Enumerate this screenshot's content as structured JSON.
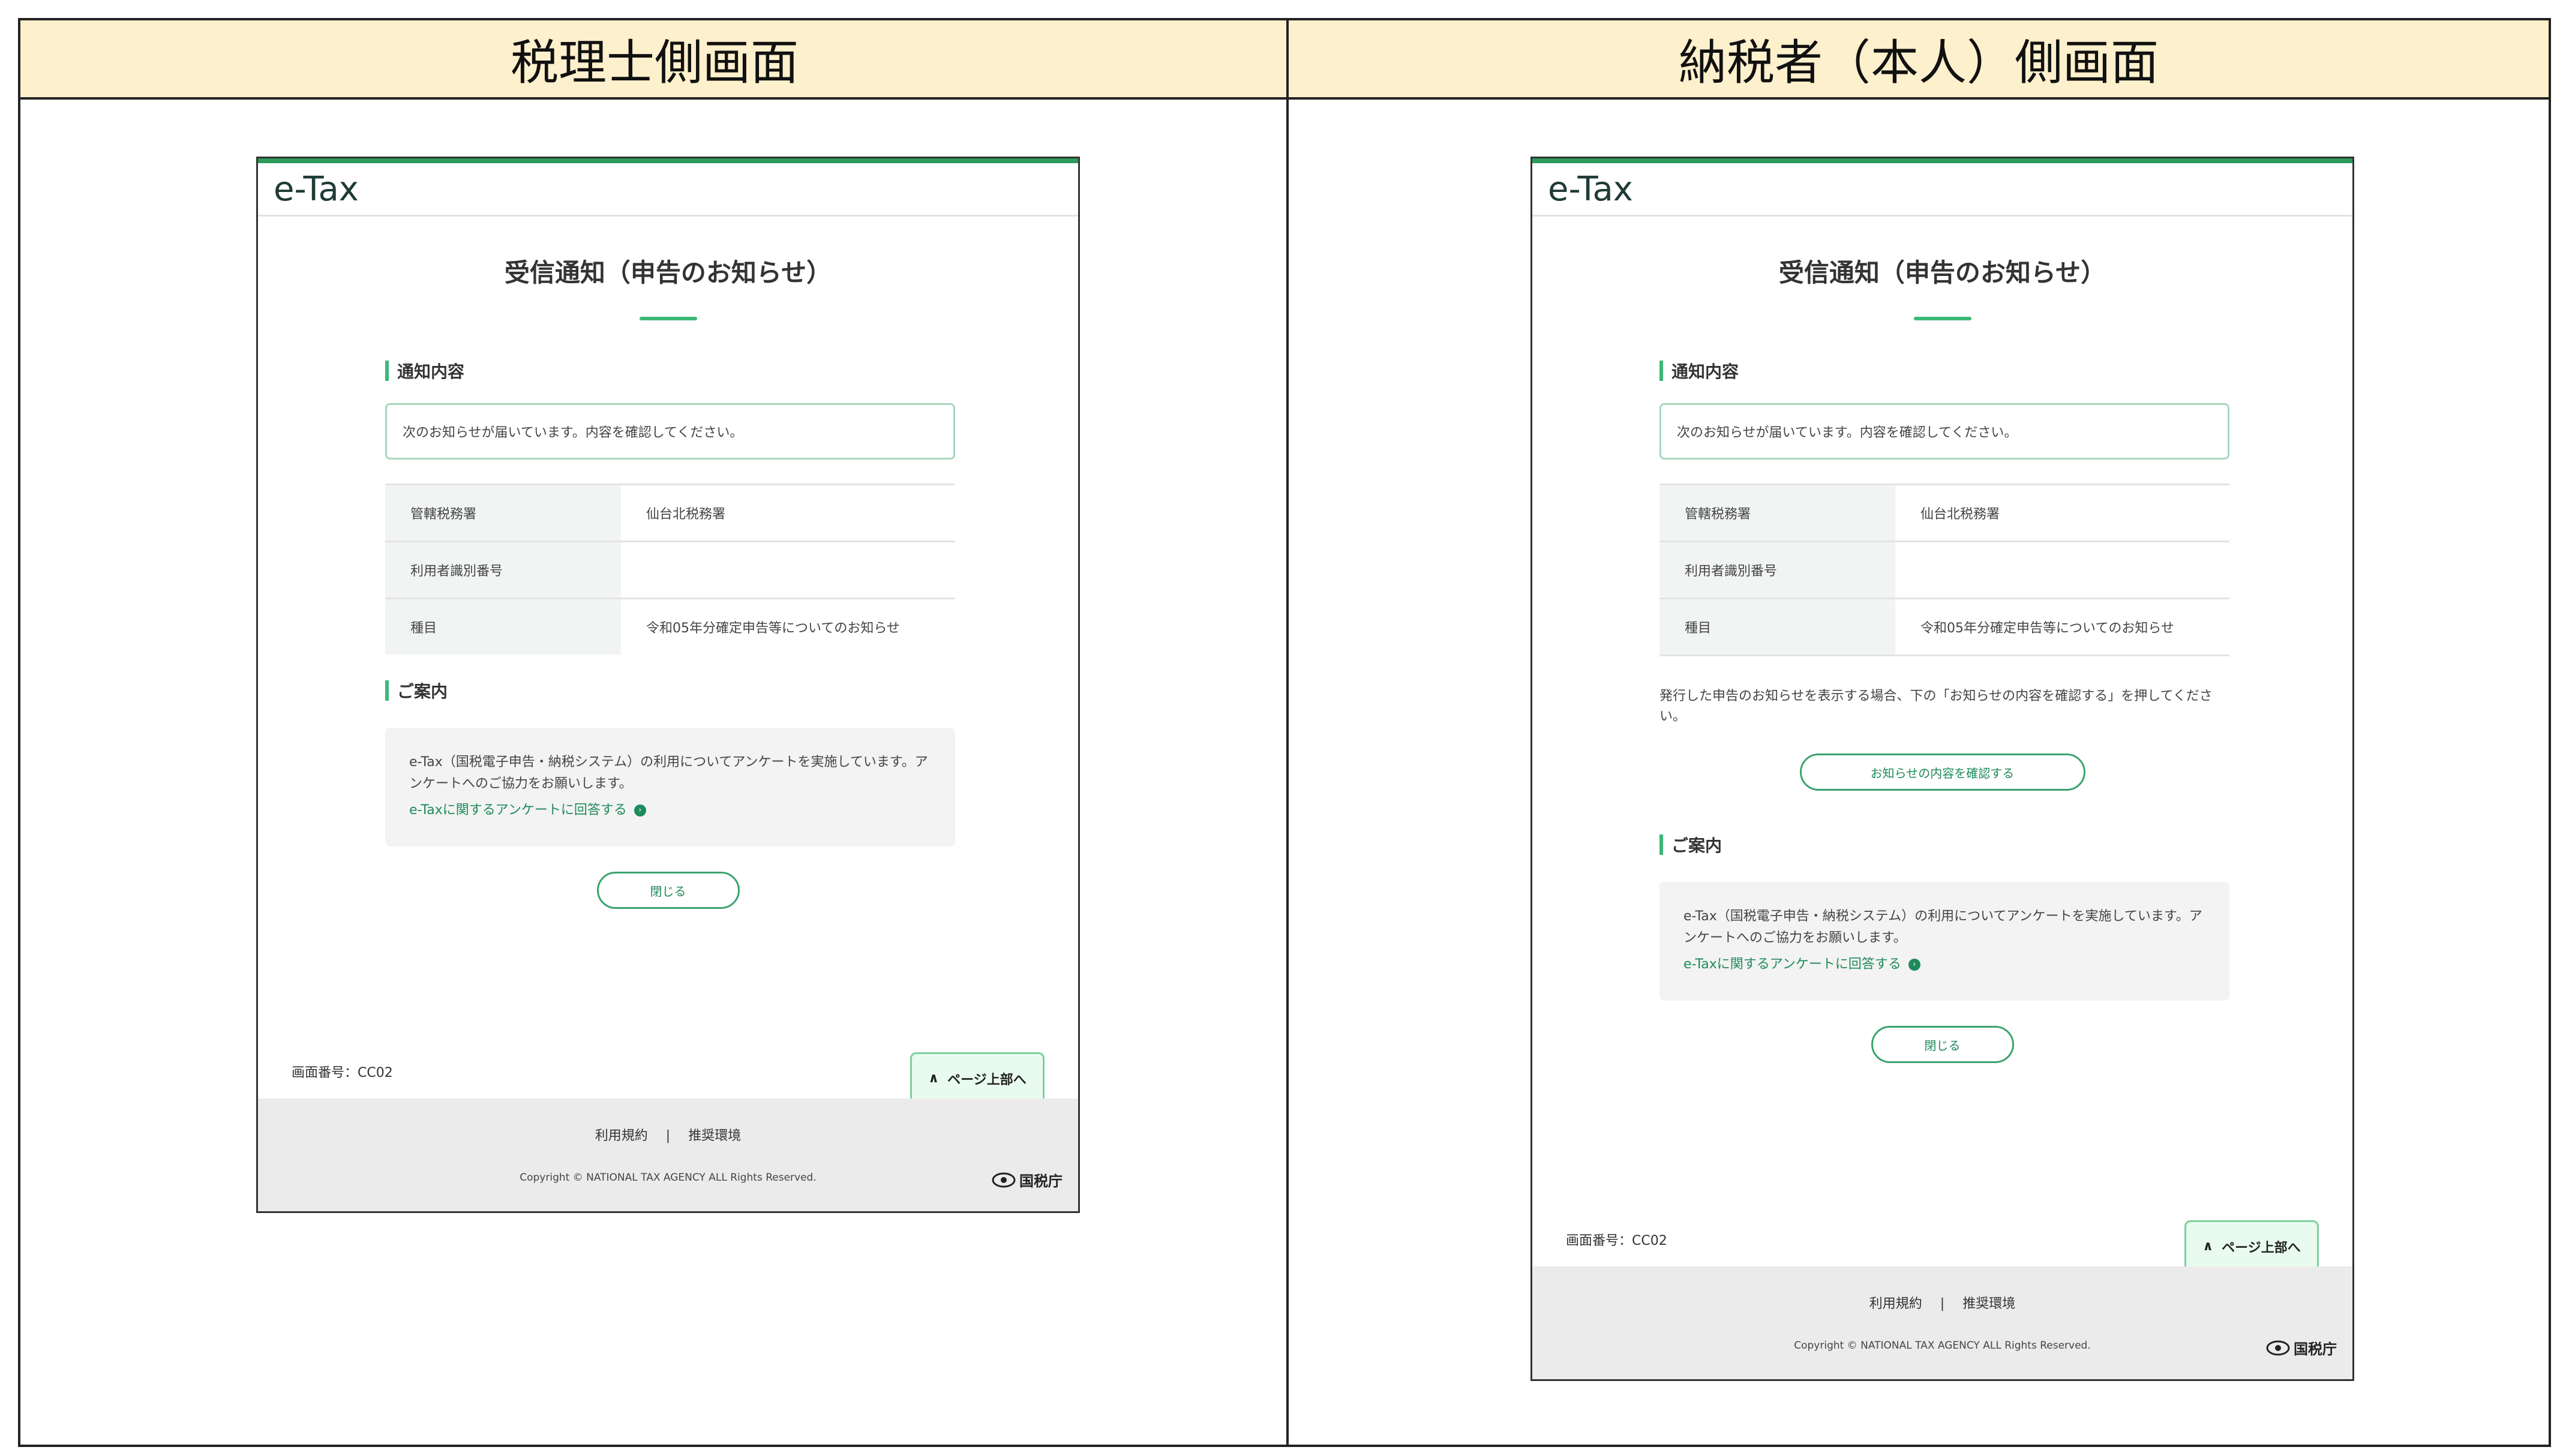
{
  "headers": {
    "left": "税理士側画面",
    "right": "納税者（本人）側画面"
  },
  "screen": {
    "brand": "e-Tax",
    "title": "受信通知（申告のお知らせ）",
    "notice_heading": "通知内容",
    "notice_text": "次のお知らせが届いています。内容を確認してください。",
    "rows": [
      {
        "label": "管轄税務署",
        "value": "仙台北税務署"
      },
      {
        "label": "利用者識別番号",
        "value": ""
      },
      {
        "label": "種目",
        "value": "令和05年分確定申告等についてのお知らせ"
      }
    ],
    "instruction": "発行した申告のお知らせを表示する場合、下の「お知らせの内容を確認する」を押してください。",
    "confirm_button": "お知らせの内容を確認する",
    "guide_heading": "ご案内",
    "guide_text": "e-Tax（国税電子申告・納税システム）の利用についてアンケートを実施しています。アンケートへのご協力をお願いします。",
    "guide_link": "e-Taxに関するアンケートに回答する",
    "close_button": "閉じる",
    "screen_number": "画面番号：CC02",
    "page_top": "ページ上部へ",
    "footer_terms": "利用規約",
    "footer_sep": "|",
    "footer_env": "推奨環境",
    "copyright": "Copyright © NATIONAL TAX AGENCY ALL Rights Reserved.",
    "nta_logo": "国税庁"
  },
  "colors": {
    "accent": "#3cb878",
    "header_bg": "#fdf0cc",
    "link": "#1f8a5c"
  }
}
